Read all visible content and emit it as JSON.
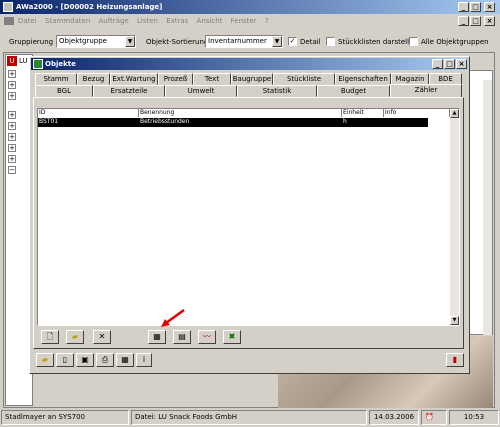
{
  "app": {
    "title": "AWa2000 - [D00002 Heizungsanlage]"
  },
  "menu": [
    "Datei",
    "Stammdaten",
    "Aufträge",
    "Listen",
    "Extras",
    "Ansicht",
    "Fenster",
    "?"
  ],
  "toolbar": {
    "grouping_label": "Gruppierung",
    "grouping_value": "Objektgruppe",
    "sort_label": "Objekt-Sortierung",
    "sort_value": "Inventarnummer",
    "detail_label": "Detail",
    "bom_label": "Stückklisten darstellen",
    "all_groups_label": "Alle Objektgruppen"
  },
  "left_panel": {
    "root_label": "LU"
  },
  "dialog": {
    "title": "Objekte",
    "tabs_row1": [
      "Stamm",
      "Bezug",
      "Ext.Wartung",
      "Prozeß",
      "Text",
      "Baugruppe",
      "Stückliste",
      "Eigenschaften",
      "Magazin",
      "BDE"
    ],
    "tabs_row2": [
      "BGL",
      "Ersatzteile",
      "Umwelt",
      "Statistik",
      "Budget",
      "Zähler"
    ],
    "active_tab": "Zähler",
    "table": {
      "columns": [
        "ID",
        "Benennung",
        "Einheit",
        "Info"
      ],
      "rows": [
        {
          "id": "BST01",
          "name": "Betriebsstunden",
          "unit": "h",
          "info": ""
        }
      ]
    },
    "buttons_row1": [
      "new-icon",
      "open-folder-icon",
      "delete-icon",
      "calculator-icon",
      "calendar-icon",
      "chart-icon",
      "excel-icon"
    ],
    "buttons_row2": [
      "open-folder-icon",
      "document-icon",
      "save-icon",
      "print-icon",
      "grid-icon",
      "info-icon"
    ],
    "info_label": "i"
  },
  "status": {
    "user": "Stadlmayer an SYS700",
    "file": "Datei: LU Snack Foods GmbH",
    "date": "14.03.2006",
    "time": "10:53"
  }
}
